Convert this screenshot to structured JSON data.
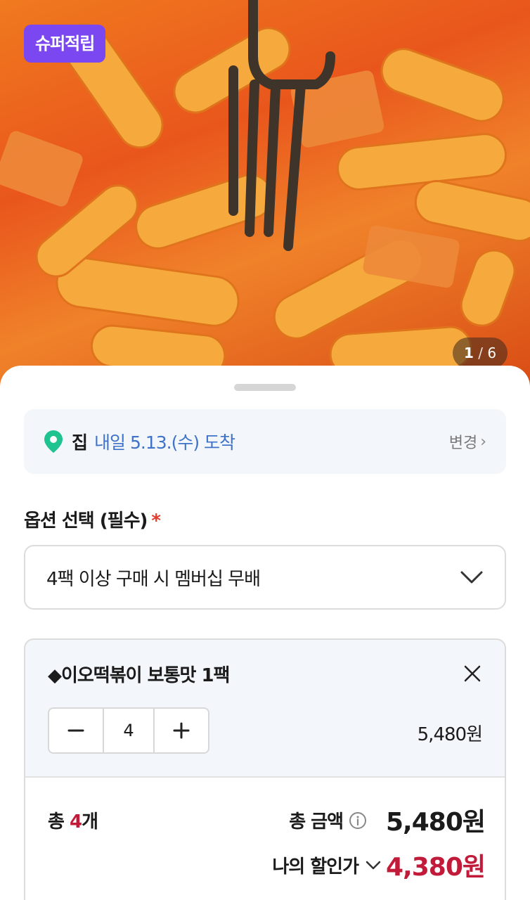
{
  "product_image": {
    "badge": "슈퍼적립",
    "pager_current": "1",
    "pager_total": "6"
  },
  "delivery": {
    "destination": "집",
    "eta": "내일 5.13.(수) 도착",
    "change_label": "변경"
  },
  "options": {
    "title": "옵션 선택 (필수)",
    "required_mark": "*",
    "selected": "4팩 이상 구매 시 멤버십 무배"
  },
  "cart_item": {
    "name": "◆이오떡볶이 보통맛 1팩",
    "quantity": "4",
    "price": "5,480원"
  },
  "summary": {
    "count_prefix": "총 ",
    "count_value": "4",
    "count_suffix": "개",
    "total_label": "총 금액",
    "total_amount": "5,480원",
    "discount_label": "나의 할인가",
    "discount_amount": "4,380원"
  },
  "colors": {
    "badge": "#7b47f0",
    "eta": "#3f73c9",
    "accent_red": "#c21b3a",
    "pin_green": "#1ec38f"
  }
}
